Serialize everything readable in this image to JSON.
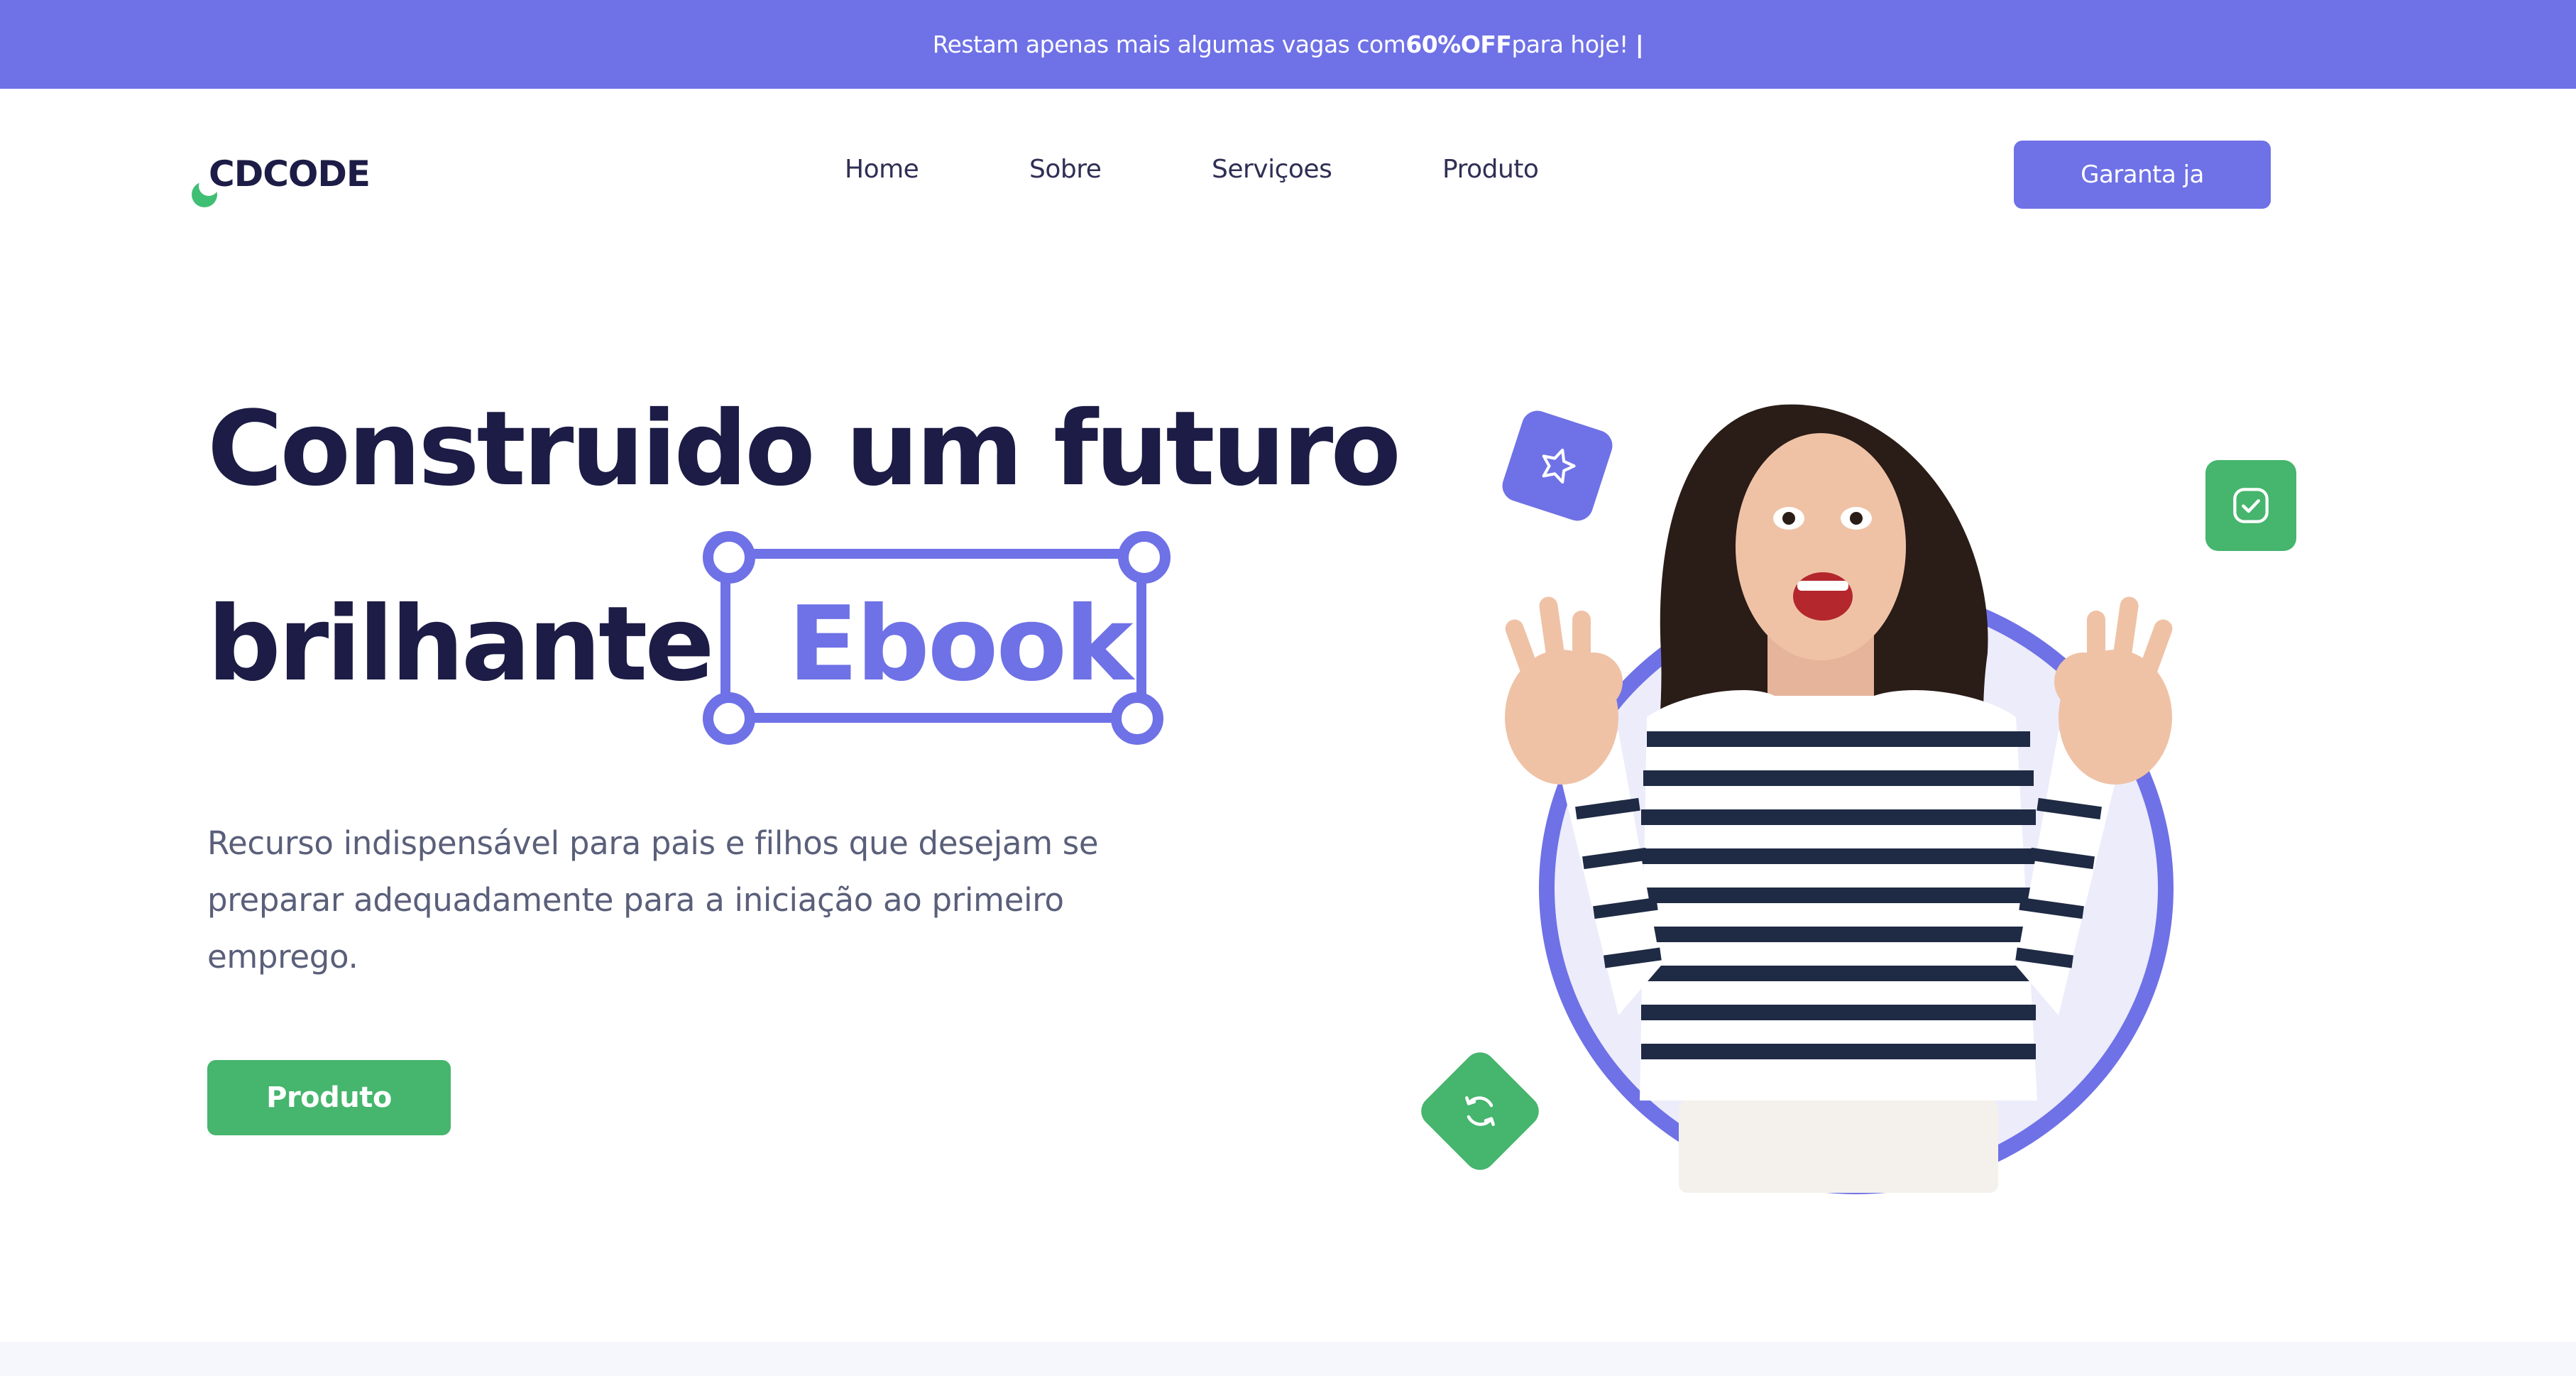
{
  "announcement": {
    "prefix": "Restam apenas mais algumas vagas com ",
    "highlight": "60%OFF",
    "suffix": " para hoje!",
    "caret": "|"
  },
  "header": {
    "logo": "CDCODE",
    "nav": [
      "Home",
      "Sobre",
      "Serviçoes",
      "Produto"
    ],
    "cta_label": "Garanta ja"
  },
  "hero": {
    "title_line1": "Construido um futuro",
    "title_line2": "brilhante",
    "highlight_word": "Ebook",
    "description": "Recurso indispensável para pais e filhos que desejam se preparar adequadamente para a iniciação ao primeiro emprego.",
    "button_label": "Produto"
  },
  "icons": {
    "star": "star-icon",
    "check": "check-icon",
    "refresh": "refresh-icon"
  },
  "colors": {
    "primary": "#6f71e6",
    "accent": "#46b56d",
    "heading": "#1c1c46",
    "body_text": "#5a5f7a"
  }
}
